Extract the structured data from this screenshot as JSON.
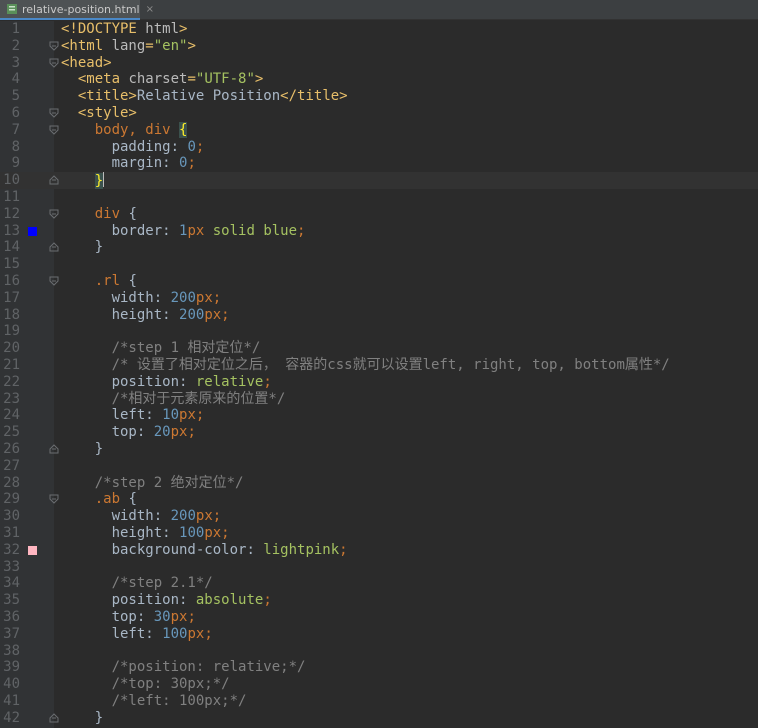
{
  "tab": {
    "file_icon": "html-file-icon",
    "label": "relative-position.html",
    "close": "×"
  },
  "editor": {
    "current_line": 10,
    "lines": [
      {
        "n": "1",
        "tokens": [
          [
            "c-tag",
            "<!DOCTYPE "
          ],
          [
            "c-attr",
            "html"
          ],
          [
            "c-tag",
            ">"
          ]
        ]
      },
      {
        "n": "2",
        "tokens": [
          [
            "c-tag",
            "<html "
          ],
          [
            "c-attr",
            "lang"
          ],
          [
            "c-tag",
            "="
          ],
          [
            "c-str",
            "\"en\""
          ],
          [
            "c-tag",
            ">"
          ]
        ]
      },
      {
        "n": "3",
        "tokens": [
          [
            "c-tag",
            "<head>"
          ]
        ]
      },
      {
        "n": "4",
        "tokens": [
          [
            "c-txt",
            "  "
          ],
          [
            "c-tag",
            "<meta "
          ],
          [
            "c-attr",
            "charset"
          ],
          [
            "c-tag",
            "="
          ],
          [
            "c-str",
            "\"UTF-8\""
          ],
          [
            "c-tag",
            ">"
          ]
        ]
      },
      {
        "n": "5",
        "tokens": [
          [
            "c-txt",
            "  "
          ],
          [
            "c-tag",
            "<title>"
          ],
          [
            "c-txt",
            "Relative Position"
          ],
          [
            "c-tag",
            "</title>"
          ]
        ]
      },
      {
        "n": "6",
        "tokens": [
          [
            "c-txt",
            "  "
          ],
          [
            "c-tag",
            "<style>"
          ]
        ]
      },
      {
        "n": "7",
        "tokens": [
          [
            "c-txt",
            "    "
          ],
          [
            "c-sel",
            "body, div "
          ],
          [
            "c-brace-hl",
            "{"
          ]
        ]
      },
      {
        "n": "8",
        "tokens": [
          [
            "c-txt",
            "      "
          ],
          [
            "c-prop",
            "padding: "
          ],
          [
            "c-num",
            "0"
          ],
          [
            "c-punc",
            ";"
          ]
        ]
      },
      {
        "n": "9",
        "tokens": [
          [
            "c-txt",
            "      "
          ],
          [
            "c-prop",
            "margin: "
          ],
          [
            "c-num",
            "0"
          ],
          [
            "c-punc",
            ";"
          ]
        ]
      },
      {
        "n": "10",
        "tokens": [
          [
            "c-txt",
            "    "
          ],
          [
            "c-brace-hl",
            "}"
          ]
        ],
        "caret": true
      },
      {
        "n": "11",
        "tokens": []
      },
      {
        "n": "12",
        "tokens": [
          [
            "c-txt",
            "    "
          ],
          [
            "c-sel",
            "div "
          ],
          [
            "c-brace",
            "{"
          ]
        ]
      },
      {
        "n": "13",
        "tokens": [
          [
            "c-txt",
            "      "
          ],
          [
            "c-prop",
            "border: "
          ],
          [
            "c-num",
            "1"
          ],
          [
            "c-sel",
            "px "
          ],
          [
            "c-val",
            "solid blue"
          ],
          [
            "c-punc",
            ";"
          ]
        ]
      },
      {
        "n": "14",
        "tokens": [
          [
            "c-txt",
            "    "
          ],
          [
            "c-brace",
            "}"
          ]
        ]
      },
      {
        "n": "15",
        "tokens": []
      },
      {
        "n": "16",
        "tokens": [
          [
            "c-txt",
            "    "
          ],
          [
            "c-sel",
            ".rl "
          ],
          [
            "c-brace",
            "{"
          ]
        ]
      },
      {
        "n": "17",
        "tokens": [
          [
            "c-txt",
            "      "
          ],
          [
            "c-prop",
            "width: "
          ],
          [
            "c-num",
            "200"
          ],
          [
            "c-sel",
            "px"
          ],
          [
            "c-punc",
            ";"
          ]
        ]
      },
      {
        "n": "18",
        "tokens": [
          [
            "c-txt",
            "      "
          ],
          [
            "c-prop",
            "height: "
          ],
          [
            "c-num",
            "200"
          ],
          [
            "c-sel",
            "px"
          ],
          [
            "c-punc",
            ";"
          ]
        ]
      },
      {
        "n": "19",
        "tokens": []
      },
      {
        "n": "20",
        "tokens": [
          [
            "c-txt",
            "      "
          ],
          [
            "c-com",
            "/*step 1 相对定位*/"
          ]
        ]
      },
      {
        "n": "21",
        "tokens": [
          [
            "c-txt",
            "      "
          ],
          [
            "c-com",
            "/* 设置了相对定位之后， 容器的css就可以设置left, right, top, bottom属性*/"
          ]
        ]
      },
      {
        "n": "22",
        "tokens": [
          [
            "c-txt",
            "      "
          ],
          [
            "c-prop",
            "position: "
          ],
          [
            "c-val",
            "relative"
          ],
          [
            "c-punc",
            ";"
          ]
        ]
      },
      {
        "n": "23",
        "tokens": [
          [
            "c-txt",
            "      "
          ],
          [
            "c-com",
            "/*相对于元素原来的位置*/"
          ]
        ]
      },
      {
        "n": "24",
        "tokens": [
          [
            "c-txt",
            "      "
          ],
          [
            "c-prop",
            "left: "
          ],
          [
            "c-num",
            "10"
          ],
          [
            "c-sel",
            "px"
          ],
          [
            "c-punc",
            ";"
          ]
        ]
      },
      {
        "n": "25",
        "tokens": [
          [
            "c-txt",
            "      "
          ],
          [
            "c-prop",
            "top: "
          ],
          [
            "c-num",
            "20"
          ],
          [
            "c-sel",
            "px"
          ],
          [
            "c-punc",
            ";"
          ]
        ]
      },
      {
        "n": "26",
        "tokens": [
          [
            "c-txt",
            "    "
          ],
          [
            "c-brace",
            "}"
          ]
        ]
      },
      {
        "n": "27",
        "tokens": []
      },
      {
        "n": "28",
        "tokens": [
          [
            "c-txt",
            "    "
          ],
          [
            "c-com",
            "/*step 2 绝对定位*/"
          ]
        ]
      },
      {
        "n": "29",
        "tokens": [
          [
            "c-txt",
            "    "
          ],
          [
            "c-sel",
            ".ab "
          ],
          [
            "c-brace",
            "{"
          ]
        ]
      },
      {
        "n": "30",
        "tokens": [
          [
            "c-txt",
            "      "
          ],
          [
            "c-prop",
            "width: "
          ],
          [
            "c-num",
            "200"
          ],
          [
            "c-sel",
            "px"
          ],
          [
            "c-punc",
            ";"
          ]
        ]
      },
      {
        "n": "31",
        "tokens": [
          [
            "c-txt",
            "      "
          ],
          [
            "c-prop",
            "height: "
          ],
          [
            "c-num",
            "100"
          ],
          [
            "c-sel",
            "px"
          ],
          [
            "c-punc",
            ";"
          ]
        ]
      },
      {
        "n": "32",
        "tokens": [
          [
            "c-txt",
            "      "
          ],
          [
            "c-prop",
            "background-color: "
          ],
          [
            "c-val",
            "lightpink"
          ],
          [
            "c-punc",
            ";"
          ]
        ]
      },
      {
        "n": "33",
        "tokens": []
      },
      {
        "n": "34",
        "tokens": [
          [
            "c-txt",
            "      "
          ],
          [
            "c-com",
            "/*step 2.1*/"
          ]
        ]
      },
      {
        "n": "35",
        "tokens": [
          [
            "c-txt",
            "      "
          ],
          [
            "c-prop",
            "position: "
          ],
          [
            "c-val",
            "absolute"
          ],
          [
            "c-punc",
            ";"
          ]
        ]
      },
      {
        "n": "36",
        "tokens": [
          [
            "c-txt",
            "      "
          ],
          [
            "c-prop",
            "top: "
          ],
          [
            "c-num",
            "30"
          ],
          [
            "c-sel",
            "px"
          ],
          [
            "c-punc",
            ";"
          ]
        ]
      },
      {
        "n": "37",
        "tokens": [
          [
            "c-txt",
            "      "
          ],
          [
            "c-prop",
            "left: "
          ],
          [
            "c-num",
            "100"
          ],
          [
            "c-sel",
            "px"
          ],
          [
            "c-punc",
            ";"
          ]
        ]
      },
      {
        "n": "38",
        "tokens": []
      },
      {
        "n": "39",
        "tokens": [
          [
            "c-txt",
            "      "
          ],
          [
            "c-com",
            "/*position: relative;*/"
          ]
        ]
      },
      {
        "n": "40",
        "tokens": [
          [
            "c-txt",
            "      "
          ],
          [
            "c-com",
            "/*top: 30px;*/"
          ]
        ]
      },
      {
        "n": "41",
        "tokens": [
          [
            "c-txt",
            "      "
          ],
          [
            "c-com",
            "/*left: 100px;*/"
          ]
        ]
      },
      {
        "n": "42",
        "tokens": [
          [
            "c-txt",
            "    "
          ],
          [
            "c-brace",
            "}"
          ]
        ]
      }
    ],
    "markers": [
      {
        "line": "13",
        "color": "#0000ff",
        "name": "color-swatch-blue"
      },
      {
        "line": "32",
        "color": "#ffb6c1",
        "name": "color-swatch-lightpink"
      }
    ],
    "folds": [
      {
        "line": "2",
        "kind": "open"
      },
      {
        "line": "3",
        "kind": "open"
      },
      {
        "line": "6",
        "kind": "open"
      },
      {
        "line": "7",
        "kind": "open"
      },
      {
        "line": "10",
        "kind": "close"
      },
      {
        "line": "12",
        "kind": "open"
      },
      {
        "line": "14",
        "kind": "close"
      },
      {
        "line": "16",
        "kind": "open"
      },
      {
        "line": "26",
        "kind": "close"
      },
      {
        "line": "29",
        "kind": "open"
      },
      {
        "line": "42",
        "kind": "close"
      }
    ]
  }
}
